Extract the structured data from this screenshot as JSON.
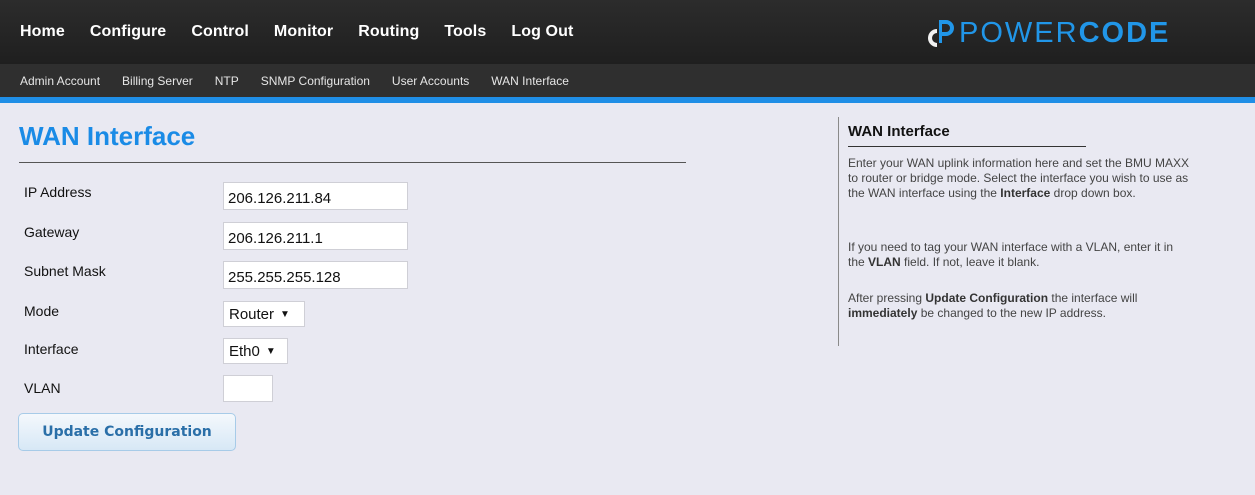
{
  "nav": {
    "main": [
      "Home",
      "Configure",
      "Control",
      "Monitor",
      "Routing",
      "Tools",
      "Log Out"
    ],
    "sub": [
      "Admin Account",
      "Billing Server",
      "NTP",
      "SNMP Configuration",
      "User Accounts",
      "WAN Interface"
    ]
  },
  "brand": {
    "text_light": "POWER",
    "text_bold": "CODE",
    "color": "#2196e8",
    "icon": "powercode-logo-icon"
  },
  "page": {
    "title": "WAN Interface"
  },
  "form": {
    "ip_label": "IP Address",
    "ip_value": "206.126.211.84",
    "gateway_label": "Gateway",
    "gateway_value": "206.126.211.1",
    "subnet_label": "Subnet Mask",
    "subnet_value": "255.255.255.128",
    "mode_label": "Mode",
    "mode_value": "Router",
    "interface_label": "Interface",
    "interface_value": "Eth0",
    "vlan_label": "VLAN",
    "vlan_value": "",
    "submit_label": "Update Configuration"
  },
  "help": {
    "title": "WAN Interface",
    "p1_a": "Enter your WAN uplink information here and set the BMU MAXX to router or bridge mode. Select the interface you wish to use as the WAN interface using the ",
    "p1_b": "Interface",
    "p1_c": " drop down box.",
    "p2_a": "If you need to tag your WAN interface with a VLAN, enter it in the ",
    "p2_b": "VLAN",
    "p2_c": " field. If not, leave it blank.",
    "p3_a": "After pressing ",
    "p3_b": "Update Configuration",
    "p3_c": " the interface will ",
    "p3_d": "immediately",
    "p3_e": " be changed to the new IP address."
  },
  "colors": {
    "accent": "#1f8ee6",
    "nav_bg": "#2c2c2c",
    "subnav_bg": "#2f2f2f",
    "page_bg": "#e9e9f2"
  }
}
